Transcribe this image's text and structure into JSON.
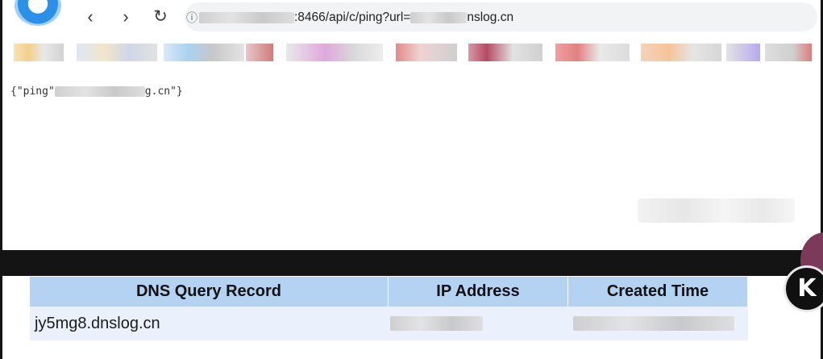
{
  "browser": {
    "address_bar": {
      "url_visible": {
        "port_path": ":8466/api/c/ping?url=",
        "host_tail": "nslog.cn"
      }
    },
    "page": {
      "json_prefix": "{\"ping\"",
      "json_suffix": "g.cn\"}"
    }
  },
  "dns_log": {
    "headers": [
      "DNS Query Record",
      "IP Address",
      "Created Time"
    ],
    "rows": [
      {
        "record": "jy5mg8.dnslog.cn"
      }
    ]
  },
  "avatar": {
    "letter": "K"
  },
  "colors": {
    "table_header_bg": "#b4d2f1",
    "table_row_bg": "#eaf0fc",
    "page_bg": "#141414"
  }
}
